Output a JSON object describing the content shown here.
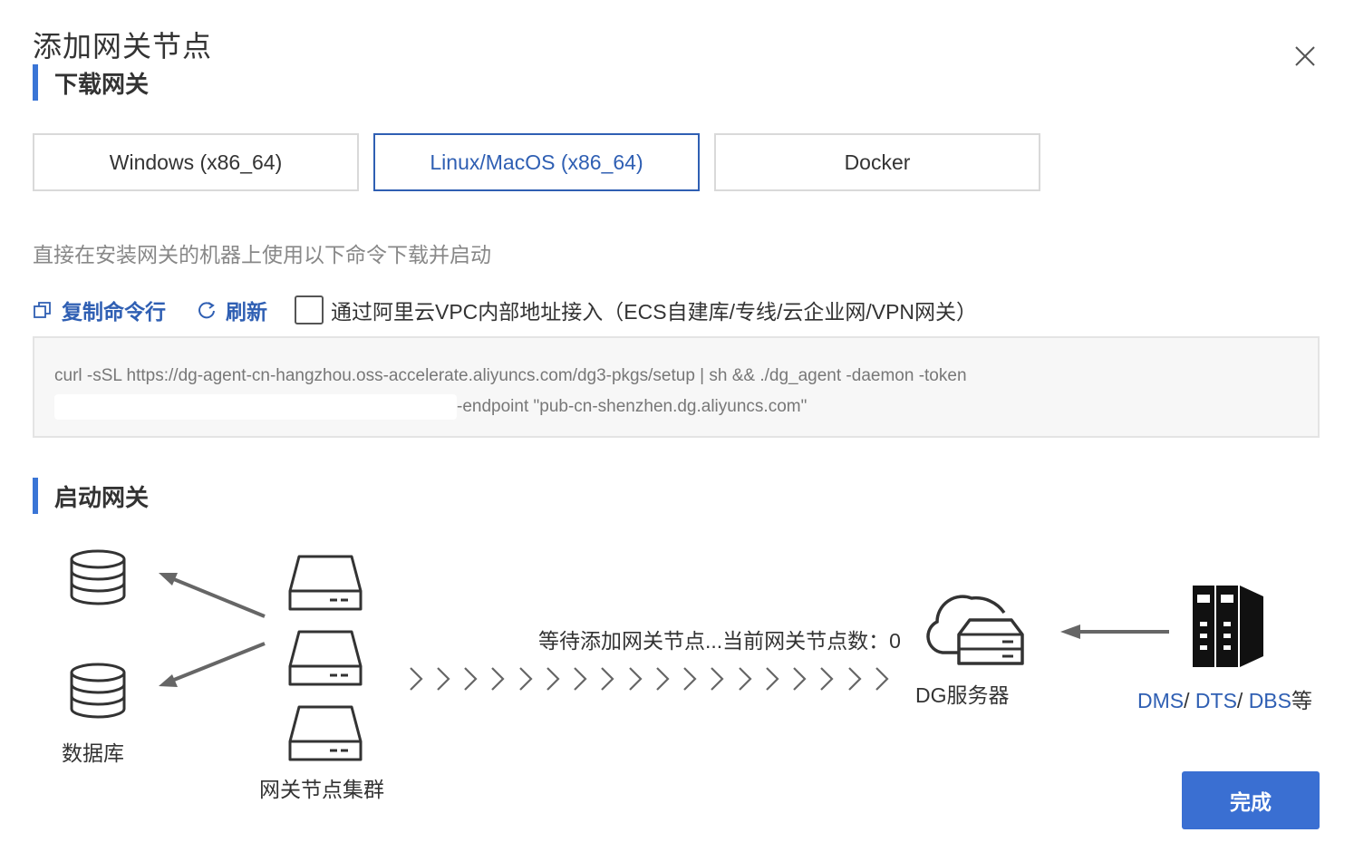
{
  "dialog": {
    "title": "添加网关节点"
  },
  "download_section": {
    "title": "下载网关",
    "tabs": [
      {
        "label": "Windows (x86_64)",
        "active": false
      },
      {
        "label": "Linux/MacOS (x86_64)",
        "active": true
      },
      {
        "label": "Docker",
        "active": false
      }
    ],
    "hint": "直接在安装网关的机器上使用以下命令下载并启动",
    "copy_label": "复制命令行",
    "refresh_label": "刷新",
    "vpc_checkbox_label": "通过阿里云VPC内部地址接入（ECS自建库/专线/云企业网/VPN网关）",
    "vpc_checked": false,
    "command_line1": "curl -sSL https://dg-agent-cn-hangzhou.oss-accelerate.aliyuncs.com/dg3-pkgs/setup | sh && ./dg_agent -daemon -token",
    "command_line2": "-endpoint \"pub-cn-shenzhen.dg.aliyuncs.com\""
  },
  "start_section": {
    "title": "启动网关",
    "database_label": "数据库",
    "cluster_label": "网关节点集群",
    "wait_text": "等待添加网关节点...当前网关节点数：0",
    "dg_server_label": "DG服务器",
    "dms_link": "DMS",
    "dts_link": "DTS",
    "dbs_link": "DBS",
    "sep": "/ ",
    "suffix": "等"
  },
  "footer": {
    "done_label": "完成"
  },
  "colors": {
    "accent": "#2f5fb3",
    "primary_button": "#3a6fd2",
    "section_bar": "#3a75d6"
  },
  "icons": [
    "close-icon",
    "copy-icon",
    "refresh-icon",
    "database-icon",
    "server-icon",
    "cloud-server-icon",
    "server-rack-icon",
    "arrow-icon",
    "chevron-right-icon"
  ]
}
